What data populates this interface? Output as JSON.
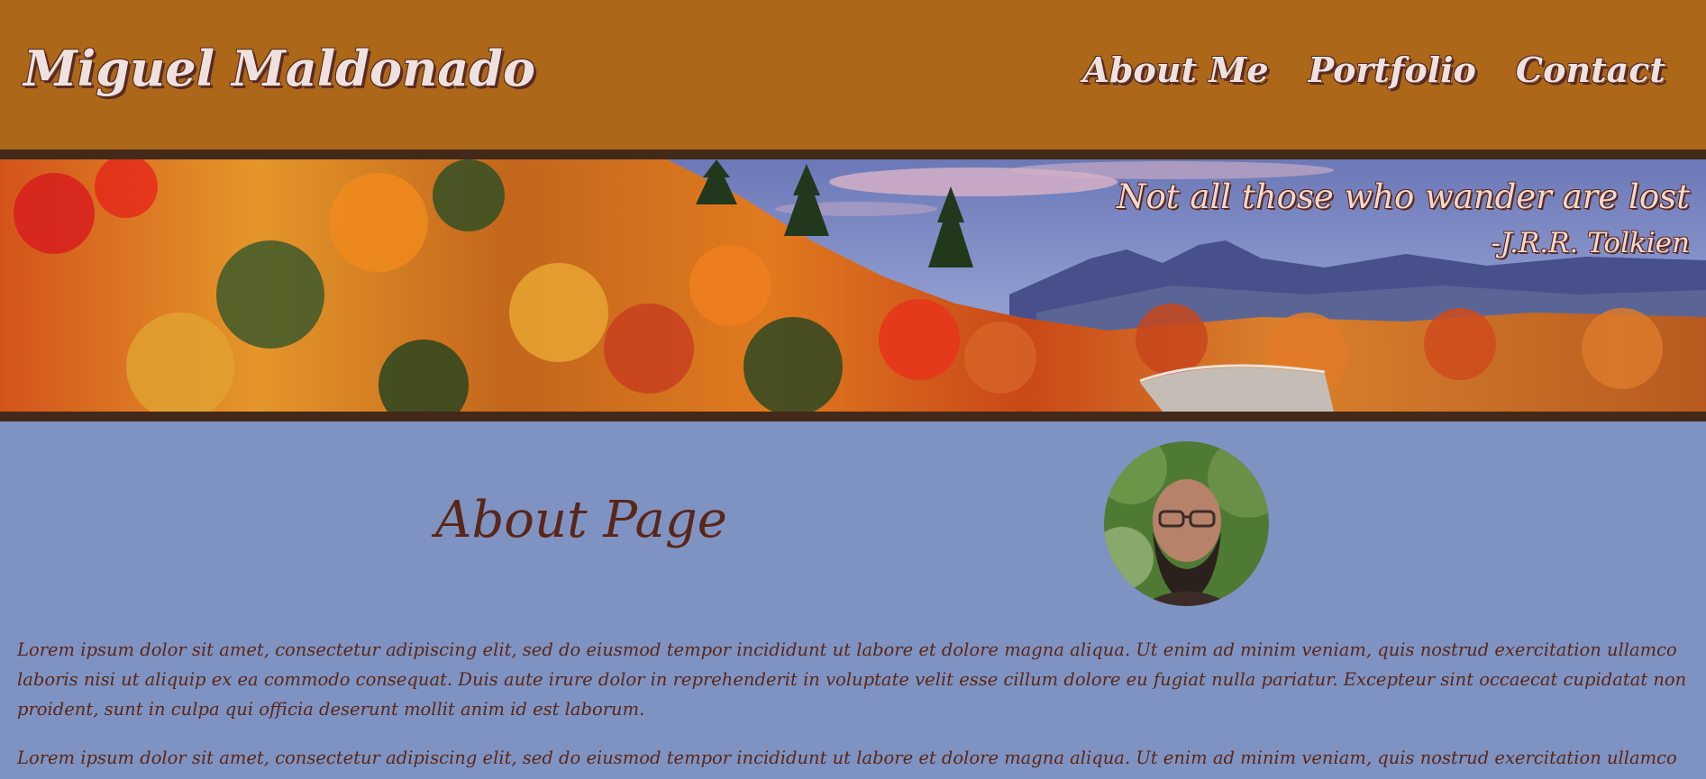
{
  "header": {
    "site_title": "Miguel Maldonado",
    "nav": [
      {
        "label": "About Me"
      },
      {
        "label": "Portfolio"
      },
      {
        "label": "Contact"
      }
    ]
  },
  "banner": {
    "quote": "Not all those who wander are lost",
    "author": "-J.R.R. Tolkien"
  },
  "main": {
    "heading": "About Page",
    "paragraphs": [
      "Lorem ipsum dolor sit amet, consectetur adipiscing elit, sed do eiusmod tempor incididunt ut labore et dolore magna aliqua. Ut enim ad minim veniam, quis nostrud exercitation ullamco laboris nisi ut aliquip ex ea commodo consequat. Duis aute irure dolor in reprehenderit in voluptate velit esse cillum dolore eu fugiat nulla pariatur. Excepteur sint occaecat cupidatat non proident, sunt in culpa qui officia deserunt mollit anim id est laborum.",
      "Lorem ipsum dolor sit amet, consectetur adipiscing elit, sed do eiusmod tempor incididunt ut labore et dolore magna aliqua. Ut enim ad minim veniam, quis nostrud exercitation ullamco"
    ]
  },
  "colors": {
    "header_bg": "#ac6719",
    "banner_border": "#42291a",
    "page_bg": "#7f93c2",
    "text": "#5a2618",
    "title_text": "#efe2de"
  },
  "images": {
    "banner": "autumn-forest-mountain-road",
    "avatar": "profile-photo"
  }
}
